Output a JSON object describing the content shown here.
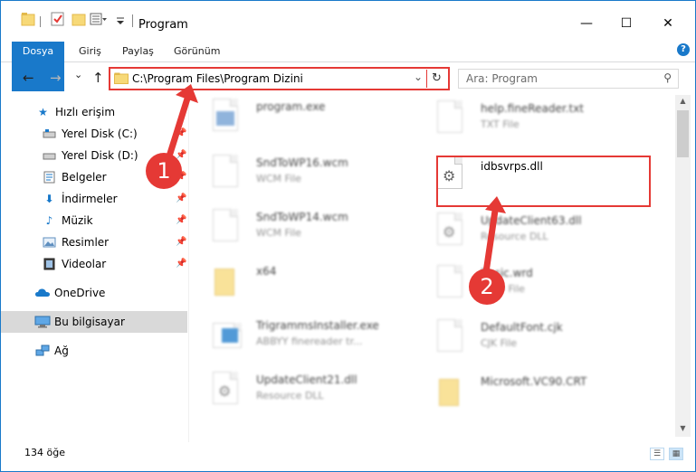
{
  "window": {
    "title": "Program",
    "minimize_glyph": "—",
    "maximize_glyph": "☐",
    "close_glyph": "✕"
  },
  "ribbon": {
    "tabs": [
      "Dosya",
      "Giriş",
      "Paylaş",
      "Görünüm"
    ],
    "help_glyph": "?"
  },
  "nav": {
    "back_glyph": "←",
    "forward_glyph": "→",
    "recent_glyph": "⌄",
    "up_glyph": "↑",
    "address_path": "C:\\Program Files\\Program Dizini",
    "dropdown_glyph": "⌄",
    "refresh_glyph": "↻",
    "search_placeholder": "Ara: Program",
    "search_glyph": "⚲"
  },
  "sidebar": {
    "items": [
      {
        "label": "Hızlı erişim",
        "icon": "star-icon"
      },
      {
        "label": "Yerel Disk (C:)",
        "icon": "drive-icon"
      },
      {
        "label": "Yerel Disk (D:)",
        "icon": "drive-icon"
      },
      {
        "label": "Belgeler",
        "icon": "documents-icon"
      },
      {
        "label": "İndirmeler",
        "icon": "download-icon"
      },
      {
        "label": "Müzik",
        "icon": "music-icon"
      },
      {
        "label": "Resimler",
        "icon": "pictures-icon"
      },
      {
        "label": "Videolar",
        "icon": "videos-icon"
      },
      {
        "label": "OneDrive",
        "icon": "cloud-icon"
      },
      {
        "label": "Bu bilgisayar",
        "icon": "computer-icon"
      },
      {
        "label": "Ağ",
        "icon": "network-icon"
      }
    ]
  },
  "files": {
    "left": [
      {
        "name": "program.exe",
        "type": ""
      },
      {
        "name": "SndToWP16.wcm",
        "type": "WCM File"
      },
      {
        "name": "SndToWP14.wcm",
        "type": "WCM File"
      },
      {
        "name": "x64",
        "type": ""
      },
      {
        "name": "TrigrammsInstaller.exe",
        "type": "ABBYY finereader tr..."
      },
      {
        "name": "UpdateClient21.dll",
        "type": "Resource DLL"
      }
    ],
    "right": [
      {
        "name": "help.fineReader.txt",
        "type": "TXT File"
      },
      {
        "name": "idbsvrps.dll",
        "type": ""
      },
      {
        "name": "UpdateClient63.dll",
        "type": "Resource DLL"
      },
      {
        "name": "Basic.wrd",
        "type": "WRD File"
      },
      {
        "name": "DefaultFont.cjk",
        "type": "CJK File"
      },
      {
        "name": "Microsoft.VC90.CRT",
        "type": ""
      }
    ]
  },
  "status": {
    "count": "134 öğe"
  },
  "markers": {
    "one": "1",
    "two": "2"
  },
  "colors": {
    "accent": "#1979ca",
    "callout": "#e53935"
  }
}
